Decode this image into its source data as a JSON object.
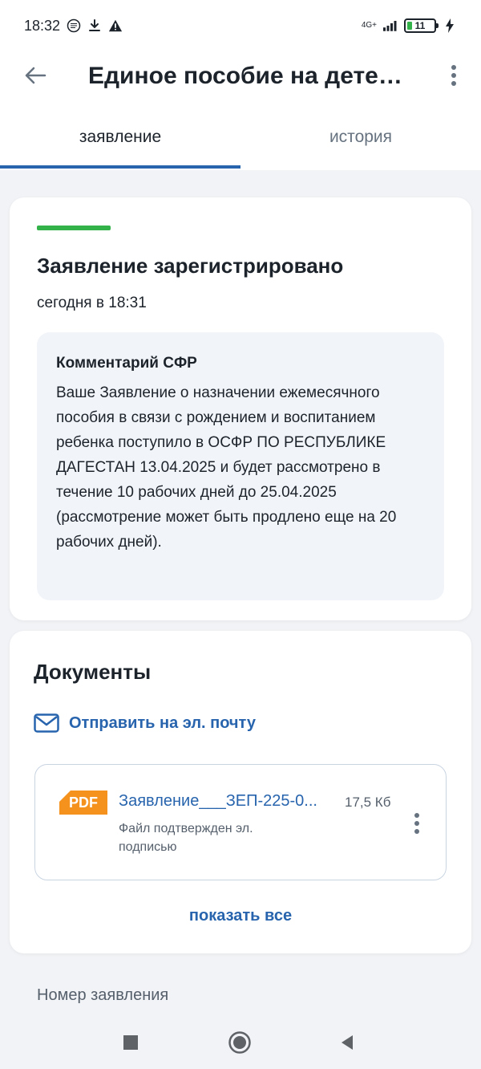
{
  "status_bar": {
    "time": "18:32",
    "network": "4G+",
    "battery": "11"
  },
  "header": {
    "title": "Единое пособие на детей..."
  },
  "tabs": [
    {
      "label": "заявление",
      "active": true
    },
    {
      "label": "история",
      "active": false
    }
  ],
  "status_card": {
    "title": "Заявление зарегистрировано",
    "time": "сегодня в 18:31",
    "status_color": "#33b24a",
    "comment_title": "Комментарий СФР",
    "comment_text": "Ваше Заявление о назначении ежемесячного пособия в связи с рождением и воспитанием ребенка поступило в ОСФР ПО РЕСПУБЛИКЕ ДАГЕСТАН 13.04.2025 и будет рассмотрено в течение 10 рабочих дней до 25.04.2025 (рассмотрение может быть продлено еще на 20 рабочих дней)."
  },
  "documents": {
    "title": "Документы",
    "email_label": "Отправить на эл. почту",
    "file": {
      "badge": "PDF",
      "name": "Заявление___ЗЕП-225-0...",
      "size": "17,5 Кб",
      "note": "Файл подтвержден эл. подписью"
    },
    "show_all": "показать все"
  },
  "footer_label": "Номер заявления",
  "colors": {
    "accent": "#2764ad",
    "pdf": "#f5921e"
  }
}
